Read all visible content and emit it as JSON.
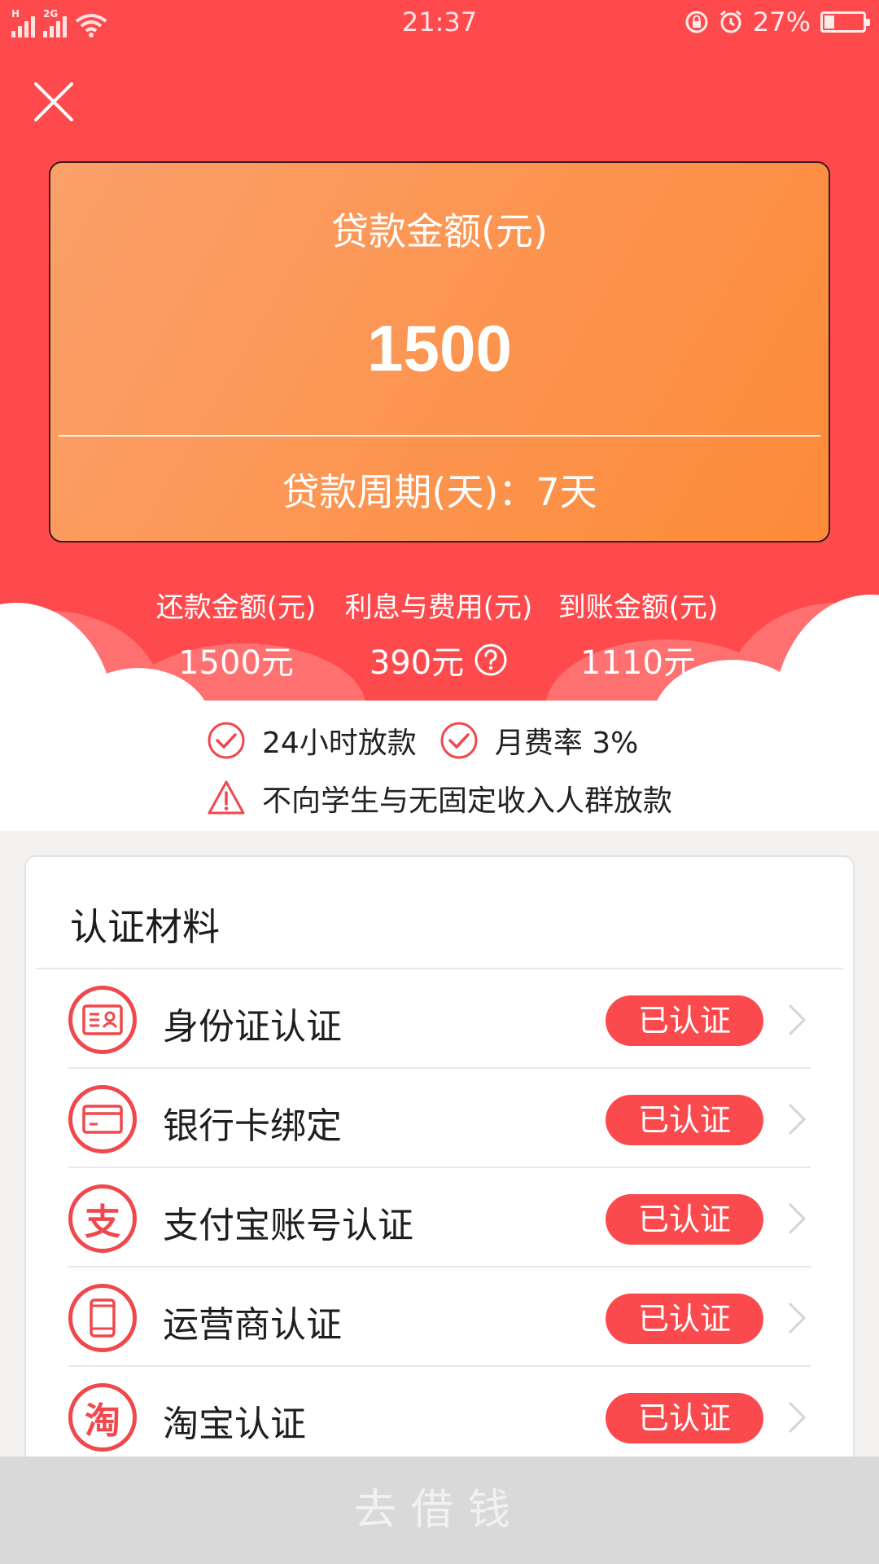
{
  "status_bar": {
    "signal_tags": [
      "H",
      "2G"
    ],
    "time": "21:37",
    "battery_percent": "27%",
    "battery_level": 0.27
  },
  "loan_card": {
    "amount_label": "贷款金额(元)",
    "amount_value": "1500",
    "period_text": "贷款周期(天)：7天"
  },
  "summary": {
    "items": [
      {
        "title": "还款金额(元)",
        "value": "1500元"
      },
      {
        "title": "利息与费用(元)",
        "value": "390元"
      },
      {
        "title": "到账金额(元)",
        "value": "1110元"
      }
    ]
  },
  "features": {
    "items": [
      "24小时放款",
      "月费率 3%"
    ],
    "warning": "不向学生与无固定收入人群放款"
  },
  "certification": {
    "title": "认证材料",
    "rows": [
      {
        "name": "身份证认证",
        "status": "已认证",
        "icon": "id-card-icon"
      },
      {
        "name": "银行卡绑定",
        "status": "已认证",
        "icon": "bank-card-icon"
      },
      {
        "name": "支付宝账号认证",
        "status": "已认证",
        "icon": "alipay-icon",
        "glyph": "支"
      },
      {
        "name": "运营商认证",
        "status": "已认证",
        "icon": "phone-icon"
      },
      {
        "name": "淘宝认证",
        "status": "已认证",
        "icon": "taobao-icon",
        "glyph": "淘"
      }
    ]
  },
  "footer": {
    "borrow_label": "去借钱"
  },
  "colors": {
    "hero_red": "#ff4a4d",
    "card_orange": "#fd8a39",
    "badge_red": "#fb4a4d",
    "button_disabled": "#d9d9d9"
  }
}
